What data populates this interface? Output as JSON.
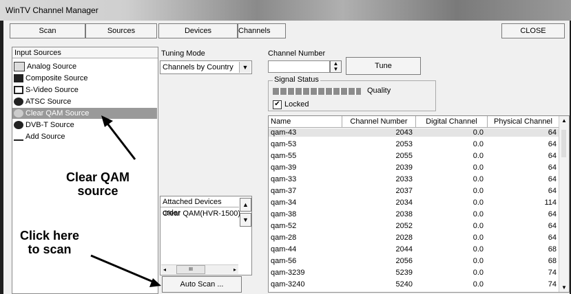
{
  "window": {
    "title": "WinTV Channel Manager"
  },
  "tabs": [
    "Scan",
    "Sources",
    "Devices",
    "Channels"
  ],
  "close_label": "CLOSE",
  "input_sources": {
    "header": "Input Sources",
    "items": [
      "Analog Source",
      "Composite Source",
      "S-Video Source",
      "ATSC Source",
      "Clear QAM Source",
      "DVB-T Source",
      "Add Source"
    ],
    "selected": "Clear QAM Source"
  },
  "tuning": {
    "label": "Tuning Mode",
    "value": "Channels by  Country"
  },
  "channel_number": {
    "label": "Channel Number",
    "value": "",
    "tune_label": "Tune"
  },
  "signal": {
    "group_label": "Signal Status",
    "quality_label": "Quality",
    "quality_fraction": 1.0,
    "locked_label": "Locked",
    "locked": true
  },
  "attached": {
    "header": "Attached Devices order",
    "items": [
      "Clear QAM(HVR-1500)"
    ],
    "scroll_glyph": "III"
  },
  "auto_scan_label": "Auto Scan ...",
  "channels": {
    "columns": [
      "Name",
      "Channel Number",
      "Digital Channel",
      "Physical Channel"
    ],
    "rows": [
      [
        "qam-43",
        "2043",
        "0.0",
        "64"
      ],
      [
        "qam-53",
        "2053",
        "0.0",
        "64"
      ],
      [
        "qam-55",
        "2055",
        "0.0",
        "64"
      ],
      [
        "qam-39",
        "2039",
        "0.0",
        "64"
      ],
      [
        "qam-33",
        "2033",
        "0.0",
        "64"
      ],
      [
        "qam-37",
        "2037",
        "0.0",
        "64"
      ],
      [
        "qam-34",
        "2034",
        "0.0",
        "114"
      ],
      [
        "qam-38",
        "2038",
        "0.0",
        "64"
      ],
      [
        "qam-52",
        "2052",
        "0.0",
        "64"
      ],
      [
        "qam-28",
        "2028",
        "0.0",
        "64"
      ],
      [
        "qam-44",
        "2044",
        "0.0",
        "68"
      ],
      [
        "qam-56",
        "2056",
        "0.0",
        "68"
      ],
      [
        "qam-3239",
        "5239",
        "0.0",
        "74"
      ],
      [
        "qam-3240",
        "5240",
        "0.0",
        "74"
      ]
    ]
  },
  "annotations": {
    "clear_qam": "Clear QAM\nsource",
    "scan": "Click here\nto scan"
  }
}
